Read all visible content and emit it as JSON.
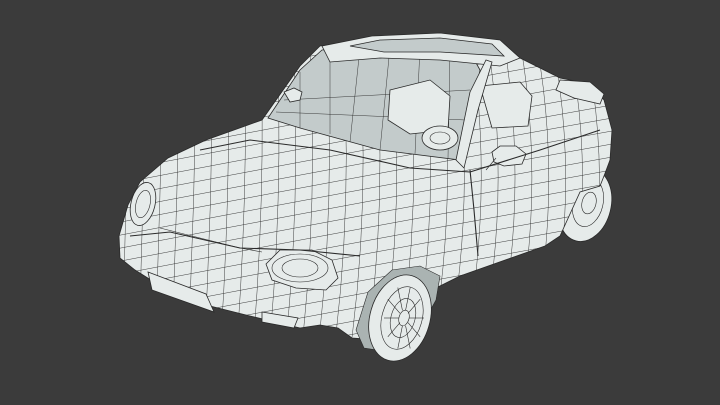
{
  "scene": {
    "background_color": "#3b3b3b",
    "mesh_fill_color": "#e6ebea",
    "wire_color": "#2a2a2a",
    "glass_color": "#c3cbcb",
    "shadow_fill_color": "#aab3b2",
    "subject": "car-wireframe-model"
  }
}
